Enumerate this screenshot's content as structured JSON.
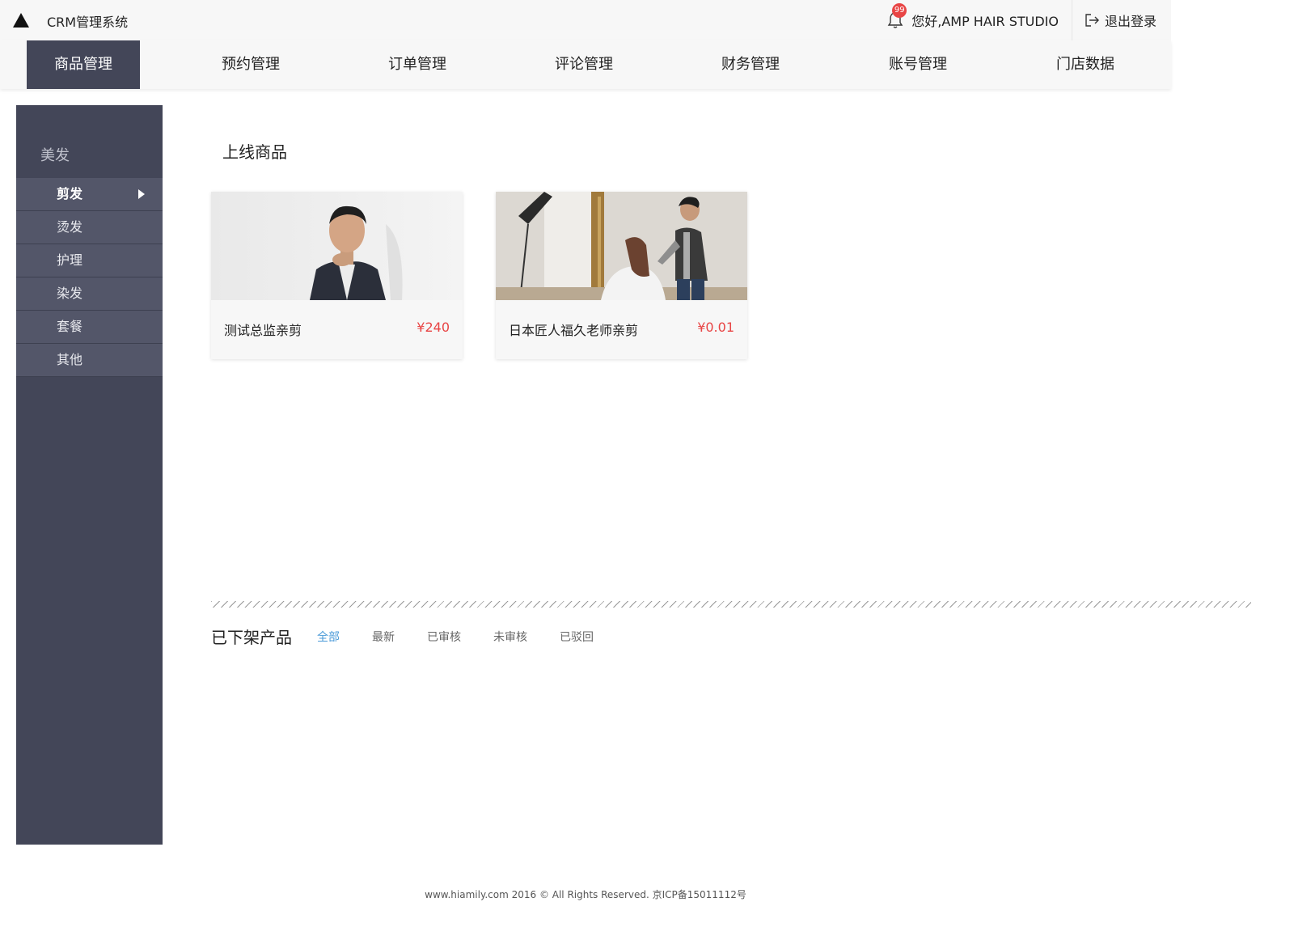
{
  "app": {
    "title": "CRM管理系统"
  },
  "header": {
    "notification_count": "99",
    "greeting": "您好,AMP HAIR STUDIO",
    "logout_label": "退出登录"
  },
  "nav": [
    {
      "label": "商品管理",
      "active": true
    },
    {
      "label": "预约管理"
    },
    {
      "label": "订单管理"
    },
    {
      "label": "评论管理"
    },
    {
      "label": "财务管理"
    },
    {
      "label": "账号管理"
    },
    {
      "label": "门店数据"
    }
  ],
  "sidebar": {
    "header": "美发",
    "items": [
      {
        "label": "剪发",
        "active": true
      },
      {
        "label": "烫发"
      },
      {
        "label": "护理"
      },
      {
        "label": "染发"
      },
      {
        "label": "套餐"
      },
      {
        "label": "其他"
      }
    ]
  },
  "online": {
    "title": "上线商品",
    "products": [
      {
        "name": "测试总监亲剪",
        "price": "¥240"
      },
      {
        "name": "日本匠人福久老师亲剪",
        "price": "¥0.01"
      }
    ]
  },
  "offline": {
    "title": "已下架产品",
    "filters": [
      {
        "label": "全部",
        "active": true
      },
      {
        "label": "最新"
      },
      {
        "label": "已审核"
      },
      {
        "label": "未审核"
      },
      {
        "label": "已驳回"
      }
    ]
  },
  "footer": {
    "text": "www.hiamily.com 2016 © All Rights Reserved. 京ICP备15011112号"
  },
  "colors": {
    "sidebar_bg": "#434658",
    "price": "#e84545",
    "filter_active": "#4a9ad8"
  }
}
